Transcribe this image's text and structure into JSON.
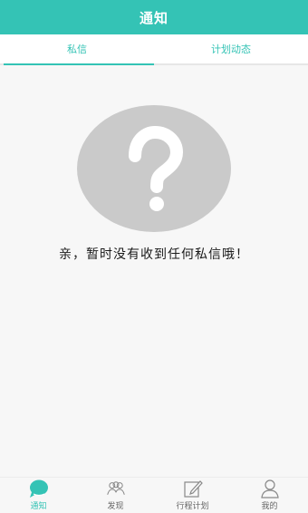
{
  "header": {
    "title": "通知"
  },
  "tabs": [
    {
      "label": "私信",
      "active": true
    },
    {
      "label": "计划动态",
      "active": false
    }
  ],
  "empty_state": {
    "icon": "question-mark-icon",
    "message": "亲，暂时没有收到任何私信哦！"
  },
  "bottom_nav": [
    {
      "label": "通知",
      "icon": "chat-bubble-icon",
      "active": true
    },
    {
      "label": "发现",
      "icon": "people-icon",
      "active": false
    },
    {
      "label": "行程计划",
      "icon": "edit-icon",
      "active": false
    },
    {
      "label": "我的",
      "icon": "person-icon",
      "active": false
    }
  ],
  "colors": {
    "accent": "#34c3b5",
    "placeholder": "#cacaca"
  }
}
